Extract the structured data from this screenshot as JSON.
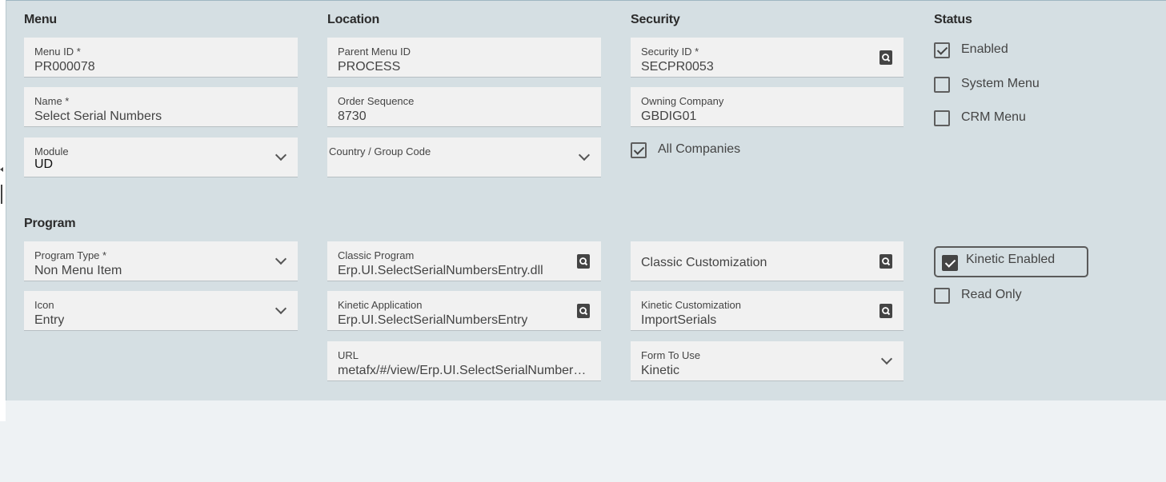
{
  "sections": {
    "menu": "Menu",
    "location": "Location",
    "security": "Security",
    "status": "Status",
    "program": "Program"
  },
  "fields": {
    "menu_id": {
      "label": "Menu ID *",
      "value": "PR000078"
    },
    "name": {
      "label": "Name *",
      "value": "Select Serial Numbers"
    },
    "module": {
      "label": "Module",
      "value": "UD"
    },
    "parent_menu_id": {
      "label": "Parent Menu ID",
      "value": "PROCESS"
    },
    "order_sequence": {
      "label": "Order Sequence",
      "value": "8730"
    },
    "country_group_code": {
      "label": "Country / Group Code",
      "value": ""
    },
    "security_id": {
      "label": "Security ID *",
      "value": "SECPR0053"
    },
    "owning_company": {
      "label": "Owning Company",
      "value": "GBDIG01"
    },
    "program_type": {
      "label": "Program Type *",
      "value": "Non Menu Item"
    },
    "icon": {
      "label": "Icon",
      "value": "Entry"
    },
    "classic_program": {
      "label": "Classic Program",
      "value": "Erp.UI.SelectSerialNumbersEntry.dll"
    },
    "kinetic_application": {
      "label": "Kinetic Application",
      "value": "Erp.UI.SelectSerialNumbersEntry"
    },
    "url": {
      "label": "URL",
      "value": "metafx/#/view/Erp.UI.SelectSerialNumbersEntry"
    },
    "classic_customization": {
      "label": "Classic Customization",
      "value": ""
    },
    "kinetic_customization": {
      "label": "Kinetic Customization",
      "value": "ImportSerials"
    },
    "form_to_use": {
      "label": "Form To Use",
      "value": "Kinetic"
    }
  },
  "checkboxes": {
    "all_companies": {
      "label": "All Companies",
      "checked": true
    },
    "enabled": {
      "label": "Enabled",
      "checked": true
    },
    "system_menu": {
      "label": "System Menu",
      "checked": false
    },
    "crm_menu": {
      "label": "CRM Menu",
      "checked": false
    },
    "kinetic_enabled": {
      "label": "Kinetic Enabled",
      "checked": true
    },
    "read_only": {
      "label": "Read Only",
      "checked": false
    }
  },
  "icons": {
    "lookup": "lookup-search-icon",
    "dropdown": "chevron-down-icon"
  },
  "colors": {
    "panel_bg": "#d5dfe3",
    "field_bg": "#f1f1f1",
    "page_bg": "#eef2f4"
  }
}
